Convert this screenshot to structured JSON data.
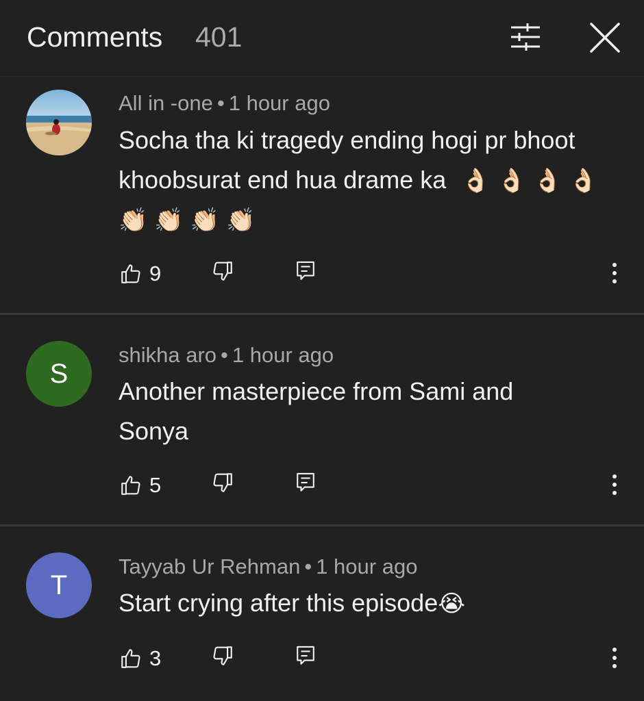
{
  "header": {
    "title": "Comments",
    "count": "401",
    "filter_icon": "sliders-icon",
    "close_icon": "close-icon"
  },
  "comments": [
    {
      "author": "All in -one",
      "separator": "•",
      "time": "1 hour ago",
      "text_line1": "Socha tha ki tragedy ending hogi pr bhoot",
      "text_line2": "khoobsurat end hua drame ka",
      "emoji_ok": "👌🏻",
      "emoji_clap": "👏🏻",
      "likes": "9",
      "avatar": "beach-photo-avatar"
    },
    {
      "author": "shikha aro",
      "separator": "•",
      "time": "1 hour ago",
      "text_line1": "Another masterpiece from Sami and",
      "text_line2": "Sonya",
      "likes": "5",
      "avatar_letter": "S",
      "avatar_color": "#2e6b21"
    },
    {
      "author": "Tayyab Ur Rehman",
      "separator": "•",
      "time": "1 hour ago",
      "text_line1": "Start crying after this episode",
      "emoji_cry": "😭",
      "likes": "3",
      "avatar_letter": "T",
      "avatar_color": "#5c6bc0"
    }
  ],
  "colors": {
    "background": "#212121",
    "text_primary": "#f1f1f1",
    "text_secondary": "#aaaaaa",
    "divider": "#3a3a3a"
  }
}
